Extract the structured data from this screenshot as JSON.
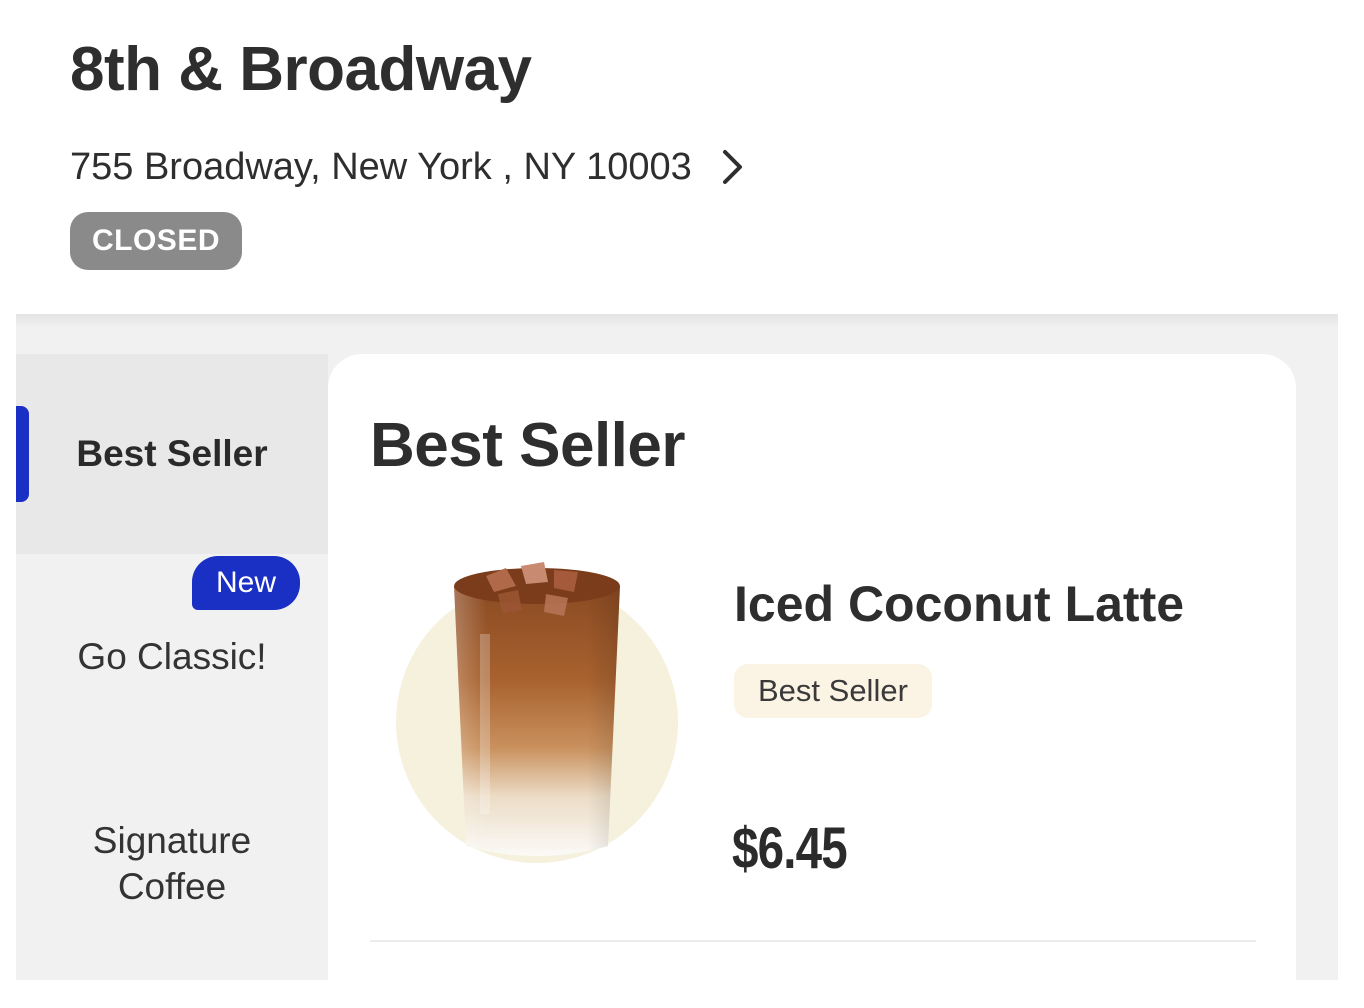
{
  "store": {
    "name": "8th & Broadway",
    "address": "755 Broadway, New York , NY 10003",
    "status": "CLOSED"
  },
  "sidebar": {
    "items": [
      {
        "label": "Best Seller",
        "active": true
      },
      {
        "label": "Go Classic!",
        "badge": "New"
      },
      {
        "label": "Signature\nCoffee"
      }
    ]
  },
  "section": {
    "title": "Best Seller"
  },
  "products": [
    {
      "name": "Iced Coconut Latte",
      "tag": "Best Seller",
      "price": "$6.45",
      "image": "iced-coconut-latte-image"
    }
  ],
  "colors": {
    "accent": "#1a2fc4",
    "status_closed": "#8a8a8a",
    "tag_background": "#fbf3e4",
    "image_circle": "#f6f1dd"
  }
}
